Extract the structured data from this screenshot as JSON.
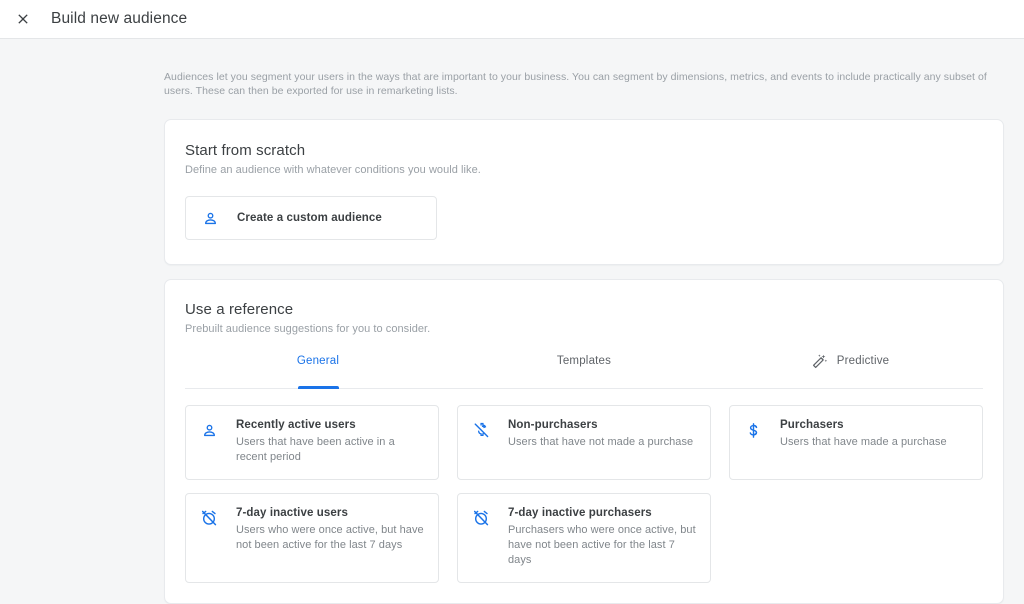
{
  "header": {
    "close_icon": "close-icon",
    "title": "Build new audience"
  },
  "intro": {
    "text": "Audiences let you segment your users in the ways that are important to your business. You can segment by dimensions, metrics, and events to include practically any subset of users. These can then be exported for use in remarketing lists."
  },
  "scratch": {
    "title": "Start from scratch",
    "subtitle": "Define an audience with whatever conditions you would like.",
    "button": {
      "icon": "person-icon",
      "label": "Create a custom audience"
    }
  },
  "reference": {
    "title": "Use a reference",
    "subtitle": "Prebuilt audience suggestions for you to consider.",
    "tabs": [
      {
        "label": "General",
        "active": true,
        "icon": ""
      },
      {
        "label": "Templates",
        "active": false,
        "icon": ""
      },
      {
        "label": "Predictive",
        "active": false,
        "icon": "magic-wand-icon"
      }
    ],
    "cards": [
      {
        "icon": "person-icon",
        "title": "Recently active users",
        "desc": "Users that have been active in a recent period"
      },
      {
        "icon": "money-off-icon",
        "title": "Non-purchasers",
        "desc": "Users that have not made a purchase"
      },
      {
        "icon": "dollar-icon",
        "title": "Purchasers",
        "desc": "Users that have made a purchase"
      },
      {
        "icon": "alarm-off-icon",
        "title": "7-day inactive users",
        "desc": "Users who were once active, but have not been active for the last 7 days"
      },
      {
        "icon": "alarm-off-icon",
        "title": "7-day inactive purchasers",
        "desc": "Purchasers who were once active, but have not been active for the last 7 days"
      }
    ]
  },
  "colors": {
    "accent": "#1a73e8",
    "icon_blue": "#1a73e8",
    "text_primary": "#3c4043",
    "text_secondary": "#80868b",
    "page_bg": "#f5f6f7",
    "card_bg": "#ffffff",
    "border": "#e4e6e8"
  }
}
